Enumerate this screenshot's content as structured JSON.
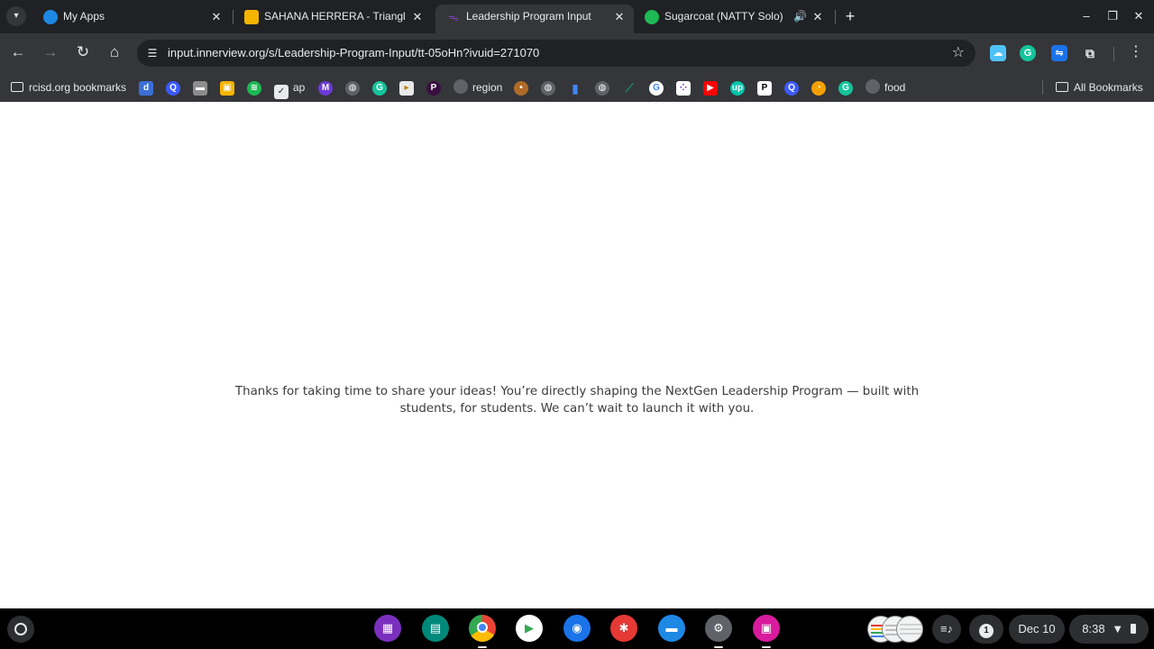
{
  "tabs": [
    {
      "title": "My Apps",
      "active": false
    },
    {
      "title": "SAHANA HERRERA - Triangle C",
      "active": false
    },
    {
      "title": "Leadership Program Input",
      "active": true
    },
    {
      "title": "Sugarcoat (NATTY Solo) · N",
      "active": false,
      "audio": true
    }
  ],
  "omnibox": {
    "url": "input.innerview.org/s/Leadership-Program-Input/tt-05oHn?ivuid=271070"
  },
  "bookmarks": {
    "folder_label": "rcisd.org bookmarks",
    "items": [
      {
        "label": "ap"
      },
      {
        "label": "region"
      },
      {
        "label": "food"
      }
    ],
    "all_bookmarks_label": "All Bookmarks"
  },
  "page": {
    "message": "Thanks for taking  time to share your ideas! You’re directly shaping the NextGen Leadership Program — built with students, for students. We can’t wait to launch it with you."
  },
  "shelf": {
    "notification_count": "1",
    "date": "Dec 10",
    "time": "8:38"
  },
  "colors": {
    "tabstrip": "#202124",
    "toolbar": "#35363a",
    "page_text": "#3c3c3c",
    "shelf": "#000000"
  }
}
